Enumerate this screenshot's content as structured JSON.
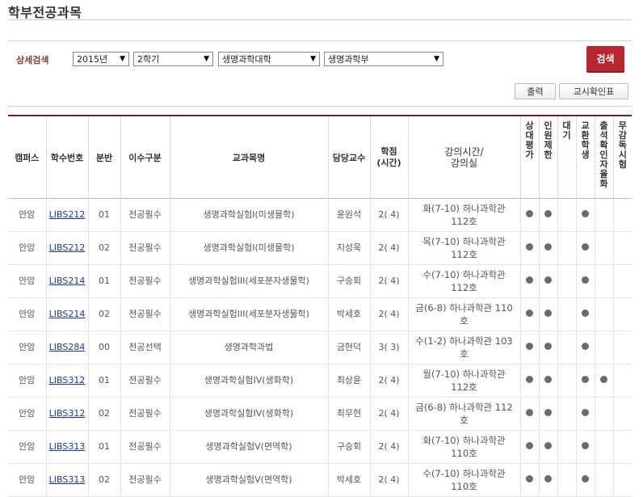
{
  "page_title": "학부전공과목",
  "search": {
    "label": "상세검색",
    "year": "2015년",
    "semester": "2학기",
    "college": "생명과학대학",
    "department": "생명과학부",
    "button": "검색"
  },
  "actions": {
    "print": "출력",
    "syllabus": "교시확인표"
  },
  "columns": {
    "campus": "캠퍼스",
    "code": "학수번호",
    "section": "분반",
    "type": "이수구분",
    "name": "교과목명",
    "prof": "담당교수",
    "credit": "학점\n(시간)",
    "time": "강의시간/\n강의실",
    "relative": "상대평가",
    "limit": "인원제한",
    "wait": "대기",
    "exchange": "교환학생",
    "attendance": "출석확인자율화",
    "nosupervision": "무감독시험"
  },
  "rows": [
    {
      "campus": "안암",
      "code": "LIBS212",
      "section": "01",
      "type": "전공필수",
      "name": "생명과학실험I(미생물학)",
      "prof": "윤원석",
      "credit": "2( 4)",
      "time": "화(7-10) 하나과학관\n112호",
      "d1": "●",
      "d2": "●",
      "d3": "",
      "d4": "●",
      "d5": "",
      "d6": ""
    },
    {
      "campus": "안암",
      "code": "LIBS212",
      "section": "02",
      "type": "전공필수",
      "name": "생명과학실험I(미생물학)",
      "prof": "지성욱",
      "credit": "2( 4)",
      "time": "목(7-10) 하나과학관\n112호",
      "d1": "●",
      "d2": "●",
      "d3": "",
      "d4": "●",
      "d5": "",
      "d6": ""
    },
    {
      "campus": "안암",
      "code": "LIBS214",
      "section": "01",
      "type": "전공필수",
      "name": "생명과학실험III(세포분자생물학)",
      "prof": "구승회",
      "credit": "2( 4)",
      "time": "수(7-10) 하나과학관\n112호",
      "d1": "●",
      "d2": "●",
      "d3": "",
      "d4": "●",
      "d5": "",
      "d6": ""
    },
    {
      "campus": "안암",
      "code": "LIBS214",
      "section": "02",
      "type": "전공필수",
      "name": "생명과학실험III(세포분자생물학)",
      "prof": "박세호",
      "credit": "2( 4)",
      "time": "금(6-8) 하나과학관 110\n호",
      "d1": "●",
      "d2": "●",
      "d3": "",
      "d4": "●",
      "d5": "",
      "d6": ""
    },
    {
      "campus": "안암",
      "code": "LIBS284",
      "section": "00",
      "type": "전공선택",
      "name": "생명과학과법",
      "prof": "금현덕",
      "credit": "3( 3)",
      "time": "수(1-2) 하나과학관 103\n호",
      "d1": "●",
      "d2": "●",
      "d3": "",
      "d4": "●",
      "d5": "",
      "d6": ""
    },
    {
      "campus": "안암",
      "code": "LIBS312",
      "section": "01",
      "type": "전공필수",
      "name": "생명과학실험IV(생화학)",
      "prof": "최상윤",
      "credit": "2( 4)",
      "time": "월(7-10) 하나과학관\n112호",
      "d1": "●",
      "d2": "●",
      "d3": "",
      "d4": "●",
      "d5": "●",
      "d6": ""
    },
    {
      "campus": "안암",
      "code": "LIBS312",
      "section": "02",
      "type": "전공필수",
      "name": "생명과학실험IV(생화학)",
      "prof": "최무현",
      "credit": "2( 4)",
      "time": "금(6-8) 하나과학관 112\n호",
      "d1": "●",
      "d2": "●",
      "d3": "",
      "d4": "●",
      "d5": "",
      "d6": ""
    },
    {
      "campus": "안암",
      "code": "LIBS313",
      "section": "01",
      "type": "전공필수",
      "name": "생명과학실험V(면역학)",
      "prof": "구승회",
      "credit": "2( 4)",
      "time": "화(7-10) 하나과학관\n110호",
      "d1": "●",
      "d2": "●",
      "d3": "",
      "d4": "●",
      "d5": "",
      "d6": ""
    },
    {
      "campus": "안암",
      "code": "LIBS313",
      "section": "02",
      "type": "전공필수",
      "name": "생명과학실험V(면역학)",
      "prof": "박세호",
      "credit": "2( 4)",
      "time": "수(7-10) 하나과학관\n110호",
      "d1": "●",
      "d2": "●",
      "d3": "",
      "d4": "●",
      "d5": "",
      "d6": ""
    }
  ]
}
